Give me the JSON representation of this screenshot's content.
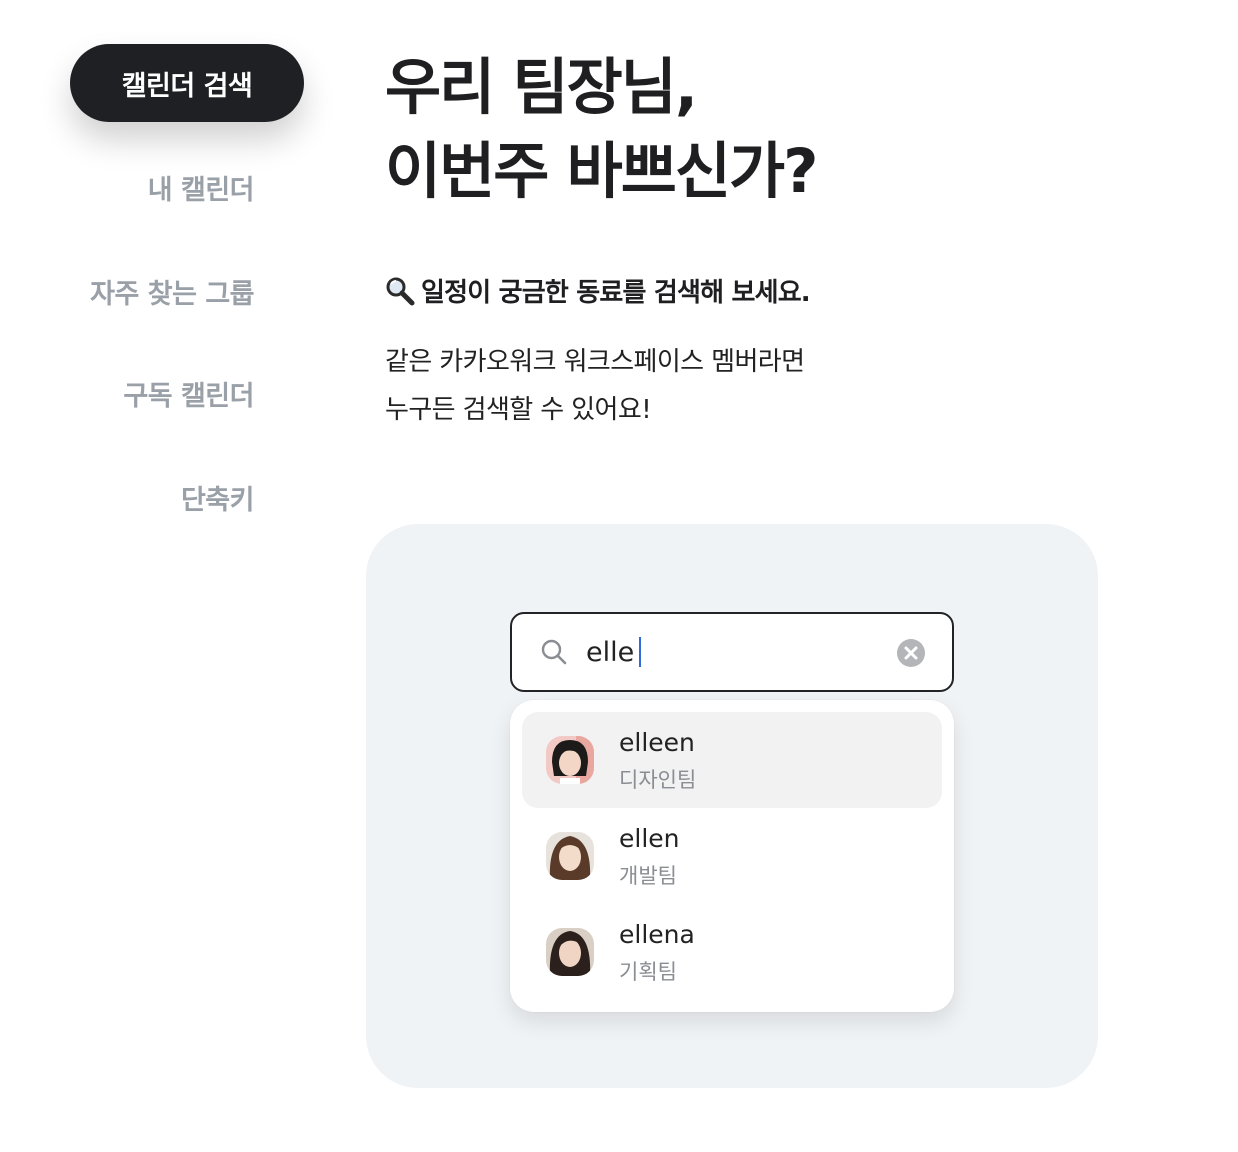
{
  "sidebar": {
    "active": "캘린더 검색",
    "items": [
      {
        "label": "내 캘린더"
      },
      {
        "label": "자주 찾는 그룹"
      },
      {
        "label": "구독 캘린더"
      },
      {
        "label": "단축키"
      }
    ]
  },
  "hero": {
    "title_line1": "우리 팀장님,",
    "title_line2": "이번주 바쁘신가?",
    "subtitle_icon": "magnifier-icon",
    "subtitle": "일정이 궁금한 동료를 검색해 보세요.",
    "desc_line1": "같은 카카오워크 워크스페이스 멤버라면",
    "desc_line2": "누구든 검색할 수 있어요!"
  },
  "search": {
    "value": "elle",
    "icon": "search-icon",
    "clear_icon": "clear-icon"
  },
  "results": [
    {
      "name": "elleen",
      "team": "디자인팀",
      "highlighted": true
    },
    {
      "name": "ellen",
      "team": "개발팀",
      "highlighted": false
    },
    {
      "name": "ellena",
      "team": "기획팀",
      "highlighted": false
    }
  ],
  "colors": {
    "nav_active_bg": "#1f2023",
    "nav_inactive_text": "#9aa0a8",
    "panel_bg": "#f0f3f6",
    "caret": "#2f6bdb",
    "highlight_row": "#f2f2f3"
  }
}
